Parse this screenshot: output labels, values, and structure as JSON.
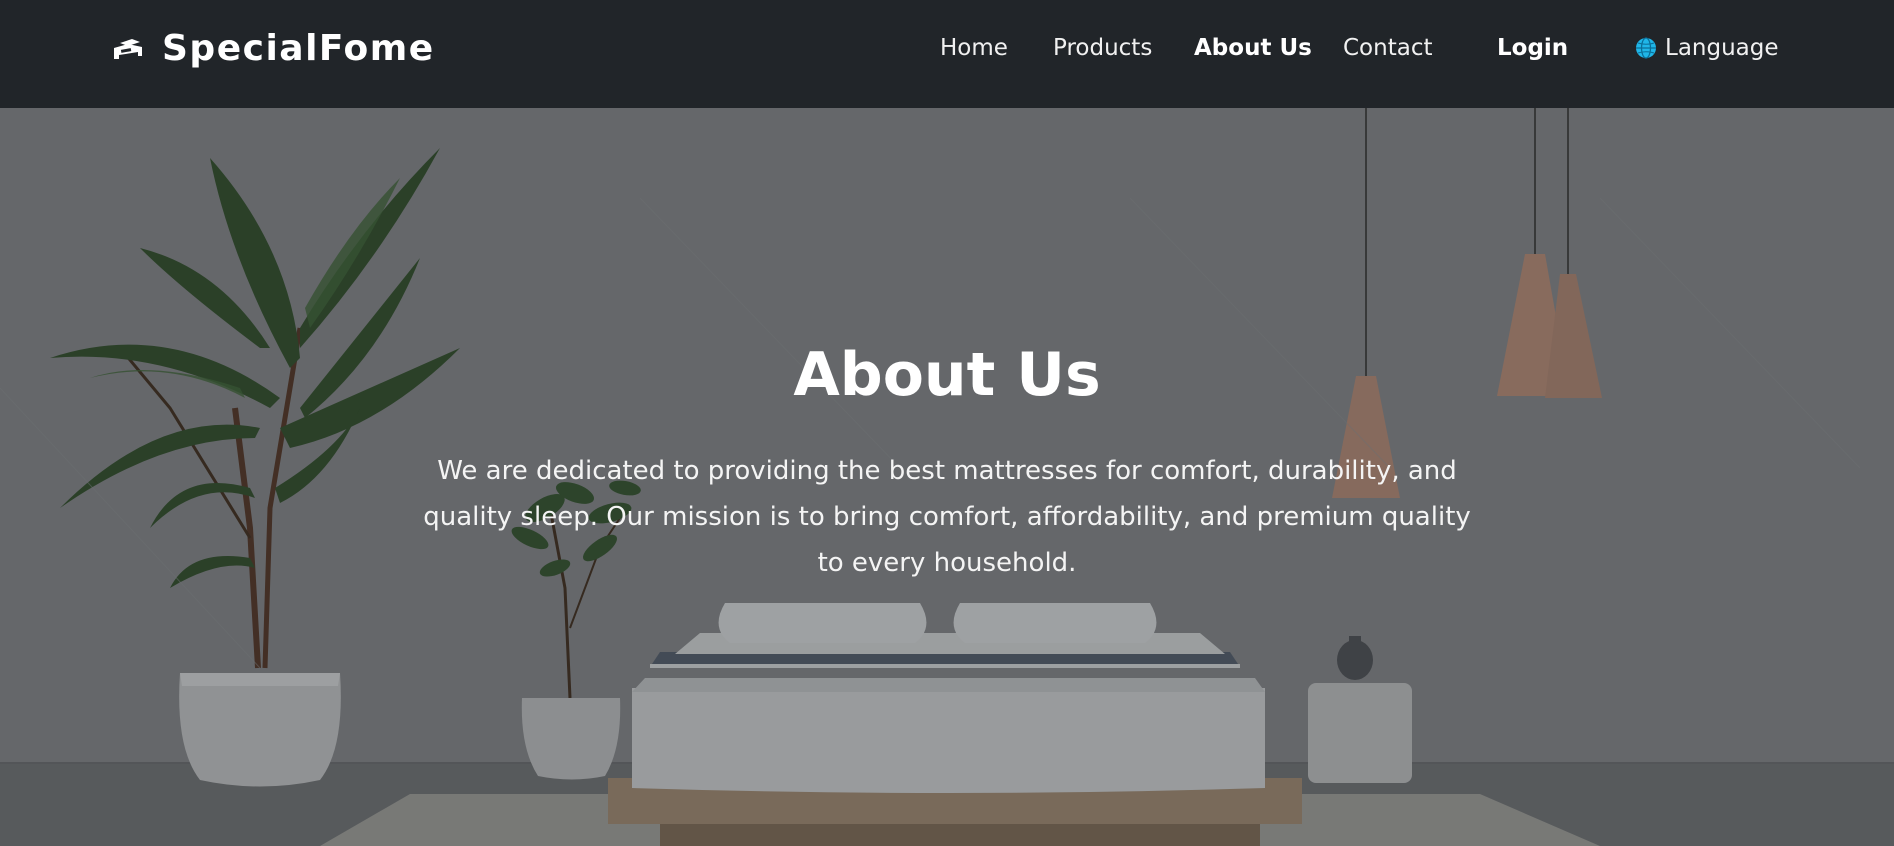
{
  "navbar": {
    "brand": "SpecialFome",
    "brand_icon": "bed-icon",
    "links": {
      "home": "Home",
      "products": "Products",
      "about": "About Us",
      "contact": "Contact"
    },
    "login": "Login",
    "language": "Language",
    "language_icon": "globe-icon",
    "colors": {
      "background": "#212529",
      "text": "#ffffff",
      "globe": "#1fb6e8"
    }
  },
  "hero": {
    "title": "About Us",
    "text": "We are dedicated to providing the best mattresses for comfort, durability, and quality sleep. Our mission is to bring comfort, affordability, and premium quality to every household."
  }
}
